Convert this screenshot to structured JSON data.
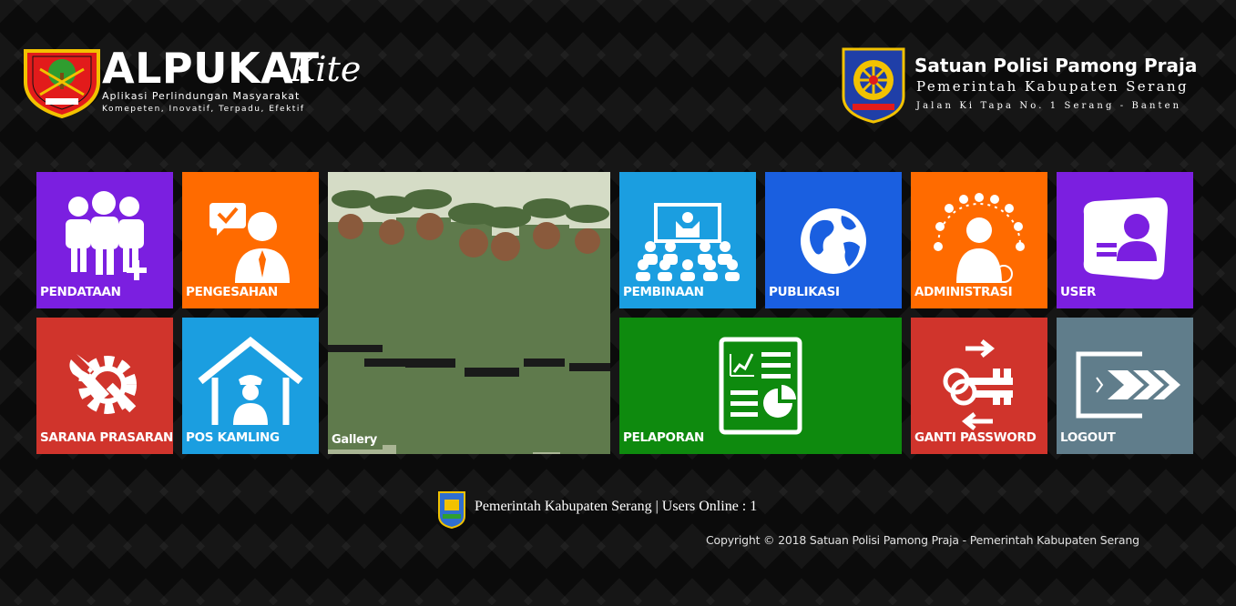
{
  "header": {
    "app_title": "ALPUKAT",
    "app_title_script": "Kite",
    "tagline": "Aplikasi Perlindungan Masyarakat",
    "motto": "Komepeten, Inovatif, Terpadu, Efektif",
    "org_name": "Satuan Polisi Pamong Praja",
    "org_gov": "Pemerintah Kabupaten Serang",
    "org_address": "Jalan Ki Tapa No. 1 Serang - Banten"
  },
  "tiles": [
    {
      "label": "PENDATAAN",
      "color": "#7b1fe0",
      "icon": "people-add-icon"
    },
    {
      "label": "PENGESAHAN",
      "color": "#ff6b00",
      "icon": "approval-person-icon"
    },
    {
      "label": "Gallery",
      "color": "#8c9a7a",
      "icon": "gallery-photo"
    },
    {
      "label": "PEMBINAAN",
      "color": "#1b9ee0",
      "icon": "presentation-audience-icon"
    },
    {
      "label": "PUBLIKASI",
      "color": "#1a5fe0",
      "icon": "globe-icon"
    },
    {
      "label": "ADMINISTRASI",
      "color": "#ff6b00",
      "icon": "admin-person-icon"
    },
    {
      "label": "USER",
      "color": "#7b1fe0",
      "icon": "user-card-icon"
    },
    {
      "label": "SARANA PRASARANA",
      "color": "#d0342c",
      "icon": "gear-wrench-icon"
    },
    {
      "label": "POS KAMLING",
      "color": "#1b9ee0",
      "icon": "guard-post-icon"
    },
    {
      "label": "PELAPORAN",
      "color": "#0e8a0e",
      "icon": "report-chart-icon"
    },
    {
      "label": "GANTI PASSWORD",
      "color": "#d0342c",
      "icon": "keys-icon"
    },
    {
      "label": "LOGOUT",
      "color": "#607d8b",
      "icon": "logout-icon"
    }
  ],
  "footer": {
    "text": "Pemerintah Kabupaten Serang | Users Online : 1",
    "copyright": "Copyright © 2018 Satuan Polisi Pamong Praja - Pemerintah Kabupaten Serang"
  }
}
